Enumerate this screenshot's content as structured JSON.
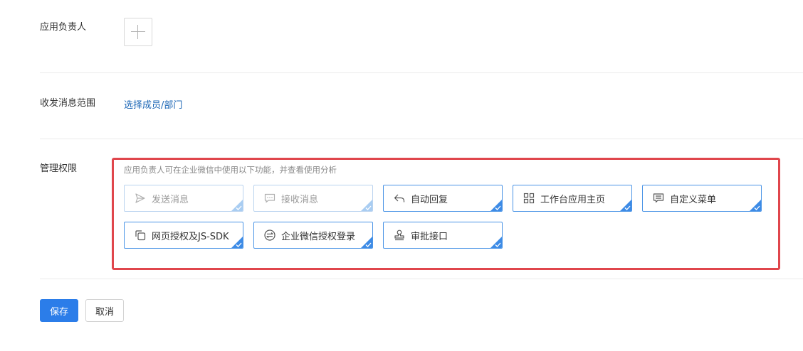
{
  "form": {
    "owner_label": "应用负责人",
    "range_label": "收发消息范围",
    "range_link": "选择成员/部门",
    "permissions_label": "管理权限",
    "permissions_hint": "应用负责人可在企业微信中使用以下功能，并查看使用分析",
    "permissions": [
      {
        "label": "发送消息",
        "icon": "send-icon",
        "state": "disabled-checked"
      },
      {
        "label": "接收消息",
        "icon": "chat-bubble-icon",
        "state": "disabled-checked"
      },
      {
        "label": "自动回复",
        "icon": "reply-icon",
        "state": "checked"
      },
      {
        "label": "工作台应用主页",
        "icon": "grid-icon",
        "state": "checked"
      },
      {
        "label": "自定义菜单",
        "icon": "menu-icon",
        "state": "checked"
      },
      {
        "label": "网页授权及JS-SDK",
        "icon": "copy-icon",
        "state": "checked"
      },
      {
        "label": "企业微信授权登录",
        "icon": "swap-icon",
        "state": "checked"
      },
      {
        "label": "审批接口",
        "icon": "stamp-icon",
        "state": "checked"
      }
    ]
  },
  "actions": {
    "save_label": "保存",
    "cancel_label": "取消"
  },
  "colors": {
    "accent": "#2b7de9",
    "link": "#1a65b5",
    "highlight_border": "#e0464c"
  }
}
